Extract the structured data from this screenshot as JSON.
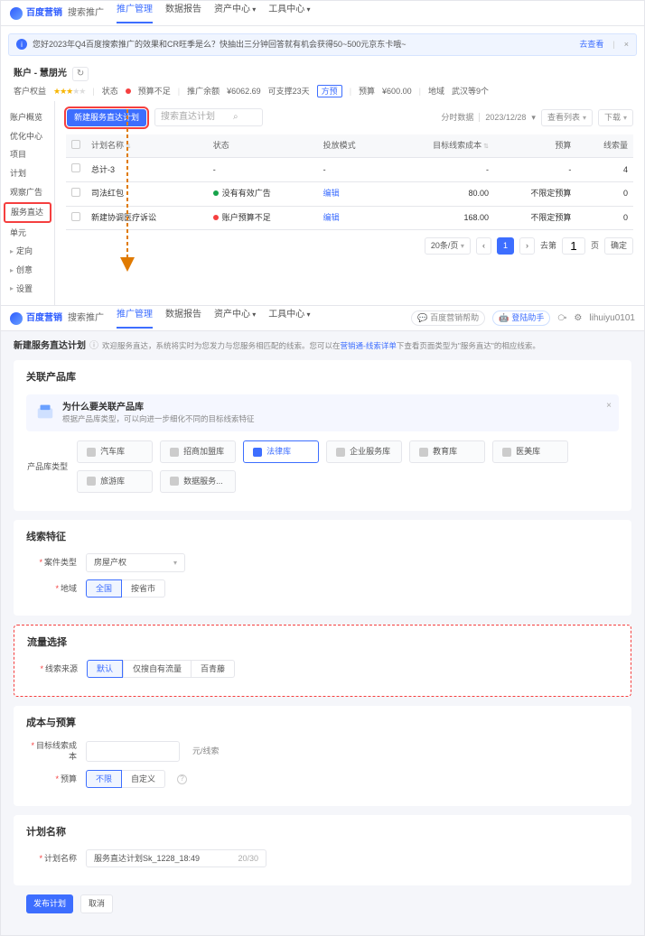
{
  "top": {
    "brand": "百度营销",
    "platform": "搜索推广",
    "nav": [
      "推广管理",
      "数据报告",
      "资产中心",
      "工具中心"
    ],
    "nav_active": 0,
    "notice": "您好2023年Q4百度搜索推广的效果和CR旺季是么？快抽出三分钟回答就有机会获得50~500元京东卡哦~",
    "notice_more": "去查看",
    "account": {
      "name": "账户 - 慧朋光",
      "label_rights": "客户权益",
      "label_status": "状态",
      "status": "预算不足",
      "label_budget": "推广余额",
      "budget": "¥6062.69",
      "budget_note1": "可支撑23天",
      "budget_note2": "方预",
      "label_pred": "预算",
      "pred": "¥600.00",
      "label_region": "地域",
      "region": "武汉等9个"
    },
    "side": [
      {
        "label": "账户概览",
        "chev": false
      },
      {
        "label": "优化中心",
        "chev": false
      },
      {
        "label": "项目",
        "chev": false
      },
      {
        "label": "计划",
        "chev": false
      },
      {
        "label": "观察广告",
        "chev": false
      },
      {
        "label": "服务直达",
        "chev": false,
        "hl": true
      },
      {
        "label": "单元",
        "chev": false
      },
      {
        "label": "定向",
        "chev": true
      },
      {
        "label": "创意",
        "chev": true
      },
      {
        "label": "设置",
        "chev": true
      }
    ],
    "toolbar": {
      "new_plan": "新建服务直达计划",
      "search_ph": "搜索直达计划",
      "time_prefix": "分时数据",
      "date": "2023/12/28",
      "col_btn": "查看列表",
      "dl_btn": "下载"
    },
    "table": {
      "cols": [
        "",
        "计划名称",
        "状态",
        "投放模式",
        "目标线索成本",
        "预算",
        "线索量"
      ],
      "rows": [
        {
          "name": "总计-3",
          "status": "-",
          "mode": "-",
          "cost": "-",
          "budget": "-",
          "leads": "4"
        },
        {
          "name": "司法红包",
          "status_dot": "green",
          "status": "没有有效广告",
          "mode": "编辑",
          "cost": "80.00",
          "budget": "不限定预算",
          "leads": "0"
        },
        {
          "name": "新建协调医疗诉讼",
          "status_dot": "red",
          "status": "账户预算不足",
          "mode": "编辑",
          "cost": "168.00",
          "budget": "不限定预算",
          "leads": "0"
        }
      ],
      "pager": {
        "size": "20条/页",
        "cur": "1",
        "jump_lbl": "去第",
        "jump_val": "1",
        "page_lbl": "页",
        "confirm": "确定"
      }
    }
  },
  "bottom": {
    "brand": "百度营销",
    "platform": "搜索推广",
    "nav": [
      "推广管理",
      "数据报告",
      "资产中心",
      "工具中心"
    ],
    "nav_active": 0,
    "right": {
      "lab1": "百度营销帮助",
      "lab2": "登陆助手",
      "user": "lihuiyu0101"
    },
    "crumb": {
      "title": "新建服务直达计划",
      "sub_a": "欢迎服务直达，系统将实时为您发力与您服务相匹配的线索。您可以在",
      "sub_link": "营销通-线索详单",
      "sub_b": "下查看页面类型为\"服务直达\"的相应线索。",
      "info": "ⓘ"
    },
    "p1": {
      "title": "关联产品库",
      "info_t": "为什么要关联产品库",
      "info_s": "根据产品库类型，可以向进一步细化不同的目标线索特征",
      "lbl": "产品库类型",
      "libs": [
        "汽车库",
        "招商加盟库",
        "法律库",
        "企业服务库",
        "教育库",
        "医美库",
        "旅游库",
        "数据服务..."
      ],
      "sel": 2
    },
    "p2": {
      "title": "线索特征",
      "lbl1": "案件类型",
      "val1": "房屋产权",
      "lbl2": "地域",
      "seg": [
        "全国",
        "按省市"
      ],
      "seg_on": 0
    },
    "p3": {
      "title": "流量选择",
      "lbl": "线索来源",
      "seg": [
        "默认",
        "仅搜自有流量",
        "百青藤"
      ],
      "seg_on": 0
    },
    "p4": {
      "title": "成本与预算",
      "lbl1": "目标线索成本",
      "val1": "",
      "unit": "元/线索",
      "lbl2": "预算",
      "seg": [
        "不限",
        "自定义"
      ],
      "seg_on": 0
    },
    "p5": {
      "title": "计划名称",
      "lbl": "计划名称",
      "val": "服务直达计划Sk_1228_18:49",
      "count": "20/30"
    },
    "foot": {
      "submit": "发布计划",
      "cancel": "取消"
    }
  }
}
